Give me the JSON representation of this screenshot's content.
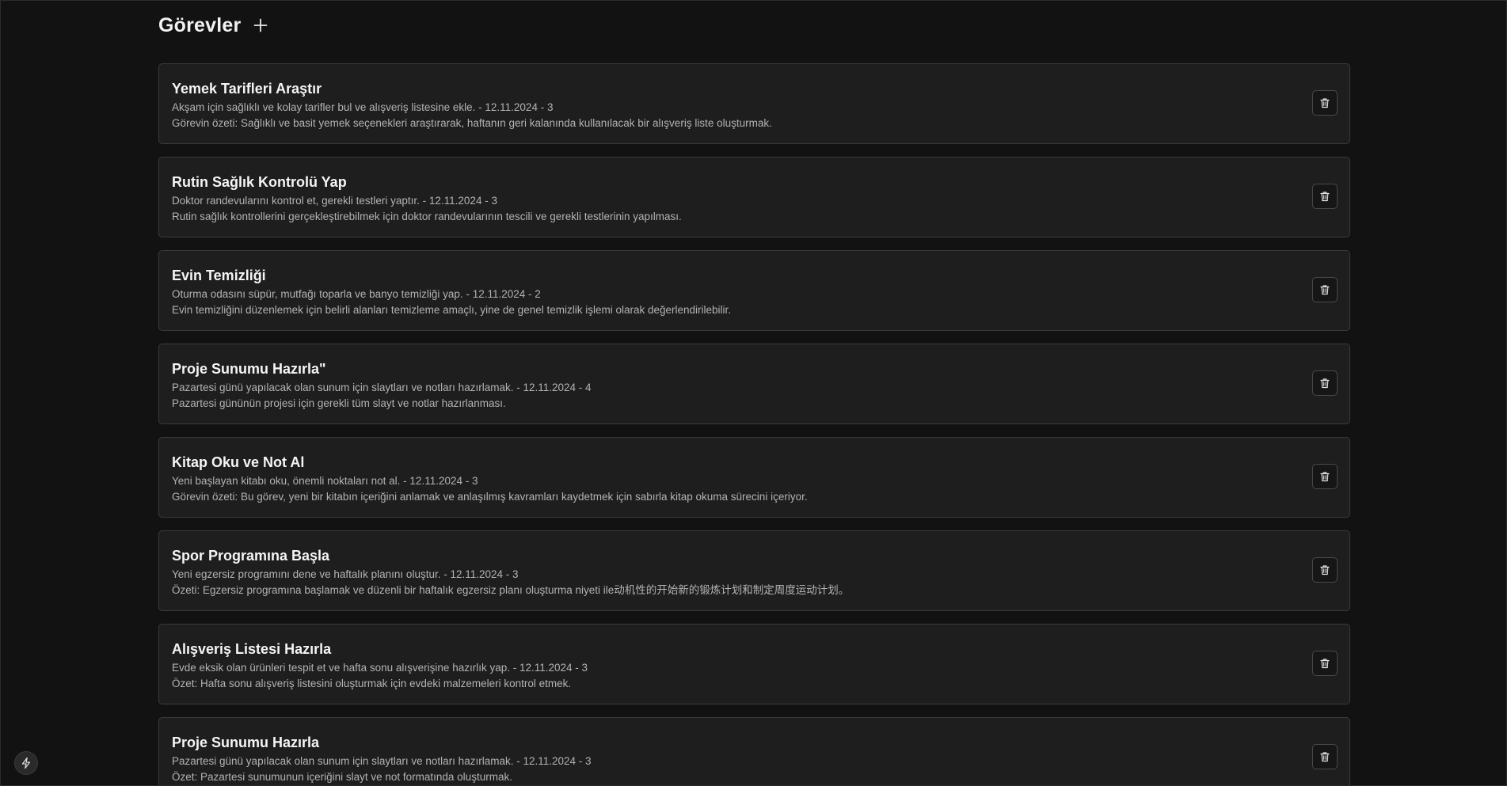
{
  "header": {
    "title": "Görevler"
  },
  "tasks": [
    {
      "title": "Yemek Tarifleri Araştır",
      "description": "Akşam için sağlıklı ve kolay tarifler bul ve alışveriş listesine ekle. - 12.11.2024 - 3",
      "summary": "Görevin özeti: Sağlıklı ve basit yemek seçenekleri araştırarak, haftanın geri kalanında kullanılacak bir alışveriş liste oluşturmak."
    },
    {
      "title": "Rutin Sağlık Kontrolü Yap",
      "description": "Doktor randevularını kontrol et, gerekli testleri yaptır. - 12.11.2024 - 3",
      "summary": "Rutin sağlık kontrollerini gerçekleştirebilmek için doktor randevularının tescili ve gerekli testlerinin yapılması."
    },
    {
      "title": "Evin Temizliği",
      "description": "Oturma odasını süpür, mutfağı toparla ve banyo temizliği yap. - 12.11.2024 - 2",
      "summary": "Evin temizliğini düzenlemek için belirli alanları temizleme amaçlı, yine de genel temizlik işlemi olarak değerlendirilebilir."
    },
    {
      "title": "Proje Sunumu Hazırla\"",
      "description": "Pazartesi günü yapılacak olan sunum için slaytları ve notları hazırlamak. - 12.11.2024 - 4",
      "summary": "Pazartesi gününün projesi için gerekli tüm slayt ve notlar hazırlanması."
    },
    {
      "title": "Kitap Oku ve Not Al",
      "description": "Yeni başlayan kitabı oku, önemli noktaları not al. - 12.11.2024 - 3",
      "summary": "Görevin özeti: Bu görev, yeni bir kitabın içeriğini anlamak ve anlaşılmış kavramları kaydetmek için sabırla kitap okuma sürecini içeriyor."
    },
    {
      "title": "Spor Programına Başla",
      "description": "Yeni egzersiz programını dene ve haftalık planını oluştur. - 12.11.2024 - 3",
      "summary": "Özeti: Egzersiz programına başlamak ve düzenli bir haftalık egzersiz planı oluşturma niyeti ile动机性的开始新的锻炼计划和制定周度运动计划。"
    },
    {
      "title": "Alışveriş Listesi Hazırla",
      "description": "Evde eksik olan ürünleri tespit et ve hafta sonu alışverişine hazırlık yap. - 12.11.2024 - 3",
      "summary": "Özet: Hafta sonu alışveriş listesini oluşturmak için evdeki malzemeleri kontrol etmek."
    },
    {
      "title": "Proje Sunumu Hazırla",
      "description": "Pazartesi günü yapılacak olan sunum için slaytları ve notları hazırlamak. - 12.11.2024 - 3",
      "summary": "Özet: Pazartesi sunumunun içeriğini slayt ve not formatında oluşturmak."
    }
  ],
  "icons": {
    "add": "plus-icon",
    "delete": "trash-icon",
    "floating": "bolt-icon"
  }
}
